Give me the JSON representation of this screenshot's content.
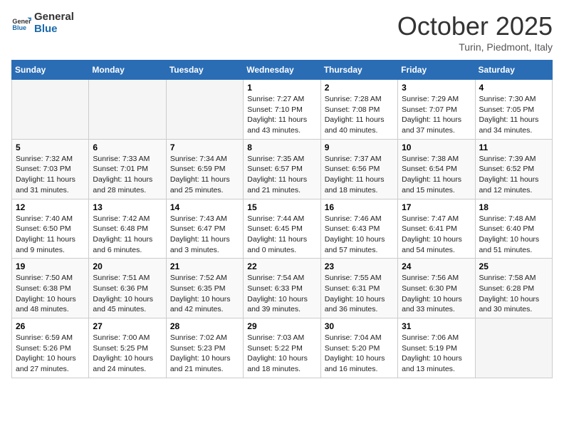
{
  "header": {
    "logo_line1": "General",
    "logo_line2": "Blue",
    "month": "October 2025",
    "location": "Turin, Piedmont, Italy"
  },
  "weekdays": [
    "Sunday",
    "Monday",
    "Tuesday",
    "Wednesday",
    "Thursday",
    "Friday",
    "Saturday"
  ],
  "weeks": [
    [
      {
        "day": "",
        "info": ""
      },
      {
        "day": "",
        "info": ""
      },
      {
        "day": "",
        "info": ""
      },
      {
        "day": "1",
        "info": "Sunrise: 7:27 AM\nSunset: 7:10 PM\nDaylight: 11 hours and 43 minutes."
      },
      {
        "day": "2",
        "info": "Sunrise: 7:28 AM\nSunset: 7:08 PM\nDaylight: 11 hours and 40 minutes."
      },
      {
        "day": "3",
        "info": "Sunrise: 7:29 AM\nSunset: 7:07 PM\nDaylight: 11 hours and 37 minutes."
      },
      {
        "day": "4",
        "info": "Sunrise: 7:30 AM\nSunset: 7:05 PM\nDaylight: 11 hours and 34 minutes."
      }
    ],
    [
      {
        "day": "5",
        "info": "Sunrise: 7:32 AM\nSunset: 7:03 PM\nDaylight: 11 hours and 31 minutes."
      },
      {
        "day": "6",
        "info": "Sunrise: 7:33 AM\nSunset: 7:01 PM\nDaylight: 11 hours and 28 minutes."
      },
      {
        "day": "7",
        "info": "Sunrise: 7:34 AM\nSunset: 6:59 PM\nDaylight: 11 hours and 25 minutes."
      },
      {
        "day": "8",
        "info": "Sunrise: 7:35 AM\nSunset: 6:57 PM\nDaylight: 11 hours and 21 minutes."
      },
      {
        "day": "9",
        "info": "Sunrise: 7:37 AM\nSunset: 6:56 PM\nDaylight: 11 hours and 18 minutes."
      },
      {
        "day": "10",
        "info": "Sunrise: 7:38 AM\nSunset: 6:54 PM\nDaylight: 11 hours and 15 minutes."
      },
      {
        "day": "11",
        "info": "Sunrise: 7:39 AM\nSunset: 6:52 PM\nDaylight: 11 hours and 12 minutes."
      }
    ],
    [
      {
        "day": "12",
        "info": "Sunrise: 7:40 AM\nSunset: 6:50 PM\nDaylight: 11 hours and 9 minutes."
      },
      {
        "day": "13",
        "info": "Sunrise: 7:42 AM\nSunset: 6:48 PM\nDaylight: 11 hours and 6 minutes."
      },
      {
        "day": "14",
        "info": "Sunrise: 7:43 AM\nSunset: 6:47 PM\nDaylight: 11 hours and 3 minutes."
      },
      {
        "day": "15",
        "info": "Sunrise: 7:44 AM\nSunset: 6:45 PM\nDaylight: 11 hours and 0 minutes."
      },
      {
        "day": "16",
        "info": "Sunrise: 7:46 AM\nSunset: 6:43 PM\nDaylight: 10 hours and 57 minutes."
      },
      {
        "day": "17",
        "info": "Sunrise: 7:47 AM\nSunset: 6:41 PM\nDaylight: 10 hours and 54 minutes."
      },
      {
        "day": "18",
        "info": "Sunrise: 7:48 AM\nSunset: 6:40 PM\nDaylight: 10 hours and 51 minutes."
      }
    ],
    [
      {
        "day": "19",
        "info": "Sunrise: 7:50 AM\nSunset: 6:38 PM\nDaylight: 10 hours and 48 minutes."
      },
      {
        "day": "20",
        "info": "Sunrise: 7:51 AM\nSunset: 6:36 PM\nDaylight: 10 hours and 45 minutes."
      },
      {
        "day": "21",
        "info": "Sunrise: 7:52 AM\nSunset: 6:35 PM\nDaylight: 10 hours and 42 minutes."
      },
      {
        "day": "22",
        "info": "Sunrise: 7:54 AM\nSunset: 6:33 PM\nDaylight: 10 hours and 39 minutes."
      },
      {
        "day": "23",
        "info": "Sunrise: 7:55 AM\nSunset: 6:31 PM\nDaylight: 10 hours and 36 minutes."
      },
      {
        "day": "24",
        "info": "Sunrise: 7:56 AM\nSunset: 6:30 PM\nDaylight: 10 hours and 33 minutes."
      },
      {
        "day": "25",
        "info": "Sunrise: 7:58 AM\nSunset: 6:28 PM\nDaylight: 10 hours and 30 minutes."
      }
    ],
    [
      {
        "day": "26",
        "info": "Sunrise: 6:59 AM\nSunset: 5:26 PM\nDaylight: 10 hours and 27 minutes."
      },
      {
        "day": "27",
        "info": "Sunrise: 7:00 AM\nSunset: 5:25 PM\nDaylight: 10 hours and 24 minutes."
      },
      {
        "day": "28",
        "info": "Sunrise: 7:02 AM\nSunset: 5:23 PM\nDaylight: 10 hours and 21 minutes."
      },
      {
        "day": "29",
        "info": "Sunrise: 7:03 AM\nSunset: 5:22 PM\nDaylight: 10 hours and 18 minutes."
      },
      {
        "day": "30",
        "info": "Sunrise: 7:04 AM\nSunset: 5:20 PM\nDaylight: 10 hours and 16 minutes."
      },
      {
        "day": "31",
        "info": "Sunrise: 7:06 AM\nSunset: 5:19 PM\nDaylight: 10 hours and 13 minutes."
      },
      {
        "day": "",
        "info": ""
      }
    ]
  ]
}
